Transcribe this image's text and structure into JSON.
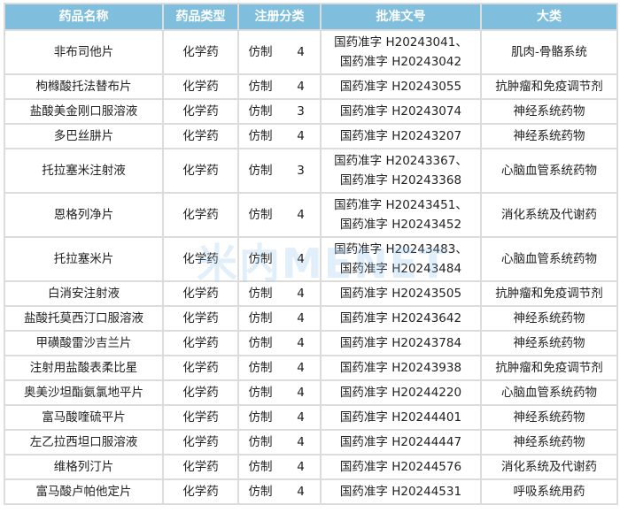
{
  "headers": [
    "药品名称",
    "药品类型",
    "注册分类",
    "批准文号",
    "大类"
  ],
  "watermark": "米内MENET",
  "rows": [
    {
      "name": "非布司他片",
      "type": "化学药",
      "reg": "仿制",
      "cls": "4",
      "approval": [
        "国药准字 H20243041、",
        "国药准字 H20243042"
      ],
      "cat": "肌肉-骨骼系统"
    },
    {
      "name": "枸橼酸托法替布片",
      "type": "化学药",
      "reg": "仿制",
      "cls": "4",
      "approval": [
        "国药准字 H20243055"
      ],
      "cat": "抗肿瘤和免疫调节剂"
    },
    {
      "name": "盐酸美金刚口服溶液",
      "type": "化学药",
      "reg": "仿制",
      "cls": "3",
      "approval": [
        "国药准字 H20243074"
      ],
      "cat": "神经系统药物"
    },
    {
      "name": "多巴丝肼片",
      "type": "化学药",
      "reg": "仿制",
      "cls": "4",
      "approval": [
        "国药准字 H20243207"
      ],
      "cat": "神经系统药物"
    },
    {
      "name": "托拉塞米注射液",
      "type": "化学药",
      "reg": "仿制",
      "cls": "3",
      "approval": [
        "国药准字 H20243367、",
        "国药准字 H20243368"
      ],
      "cat": "心脑血管系统药物"
    },
    {
      "name": "恩格列净片",
      "type": "化学药",
      "reg": "仿制",
      "cls": "4",
      "approval": [
        "国药准字 H20243451、",
        "国药准字 H20243452"
      ],
      "cat": "消化系统及代谢药"
    },
    {
      "name": "托拉塞米片",
      "type": "化学药",
      "reg": "仿制",
      "cls": "4",
      "approval": [
        "国药准字 H20243483、",
        "国药准字 H20243484"
      ],
      "cat": "心脑血管系统药物"
    },
    {
      "name": "白消安注射液",
      "type": "化学药",
      "reg": "仿制",
      "cls": "4",
      "approval": [
        "国药准字 H20243505"
      ],
      "cat": "抗肿瘤和免疫调节剂"
    },
    {
      "name": "盐酸托莫西汀口服溶液",
      "type": "化学药",
      "reg": "仿制",
      "cls": "4",
      "approval": [
        "国药准字 H20243642"
      ],
      "cat": "神经系统药物"
    },
    {
      "name": "甲磺酸雷沙吉兰片",
      "type": "化学药",
      "reg": "仿制",
      "cls": "4",
      "approval": [
        "国药准字 H20243784"
      ],
      "cat": "神经系统药物"
    },
    {
      "name": "注射用盐酸表柔比星",
      "type": "化学药",
      "reg": "仿制",
      "cls": "4",
      "approval": [
        "国药准字 H20243938"
      ],
      "cat": "抗肿瘤和免疫调节剂"
    },
    {
      "name": "奥美沙坦酯氨氯地平片",
      "type": "化学药",
      "reg": "仿制",
      "cls": "4",
      "approval": [
        "国药准字 H20244220"
      ],
      "cat": "心脑血管系统药物"
    },
    {
      "name": "富马酸喹硫平片",
      "type": "化学药",
      "reg": "仿制",
      "cls": "4",
      "approval": [
        "国药准字 H20244401"
      ],
      "cat": "神经系统药物"
    },
    {
      "name": "左乙拉西坦口服溶液",
      "type": "化学药",
      "reg": "仿制",
      "cls": "4",
      "approval": [
        "国药准字 H20244447"
      ],
      "cat": "神经系统药物"
    },
    {
      "name": "维格列汀片",
      "type": "化学药",
      "reg": "仿制",
      "cls": "4",
      "approval": [
        "国药准字 H20244576"
      ],
      "cat": "消化系统及代谢药"
    },
    {
      "name": "富马酸卢帕他定片",
      "type": "化学药",
      "reg": "仿制",
      "cls": "4",
      "approval": [
        "国药准字 H20244531"
      ],
      "cat": "呼吸系统用药"
    }
  ]
}
